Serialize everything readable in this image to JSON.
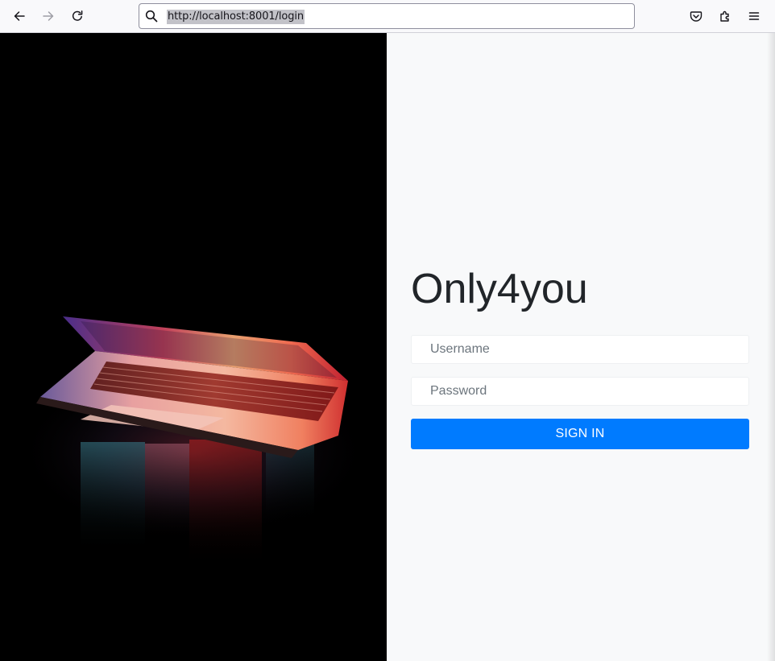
{
  "browser": {
    "url": "http://localhost:8001/login",
    "icons": {
      "back": "arrow-left-icon",
      "forward": "arrow-right-icon",
      "reload": "reload-icon",
      "search": "search-icon",
      "pocket": "pocket-icon",
      "extensions": "puzzle-icon",
      "menu": "hamburger-menu-icon"
    }
  },
  "login": {
    "brand": "Only4you",
    "username_placeholder": "Username",
    "password_placeholder": "Password",
    "submit_label": "SIGN IN"
  },
  "colors": {
    "accent": "#007bff",
    "panel_bg": "#f8f9fa",
    "hero_bg": "#000000"
  }
}
